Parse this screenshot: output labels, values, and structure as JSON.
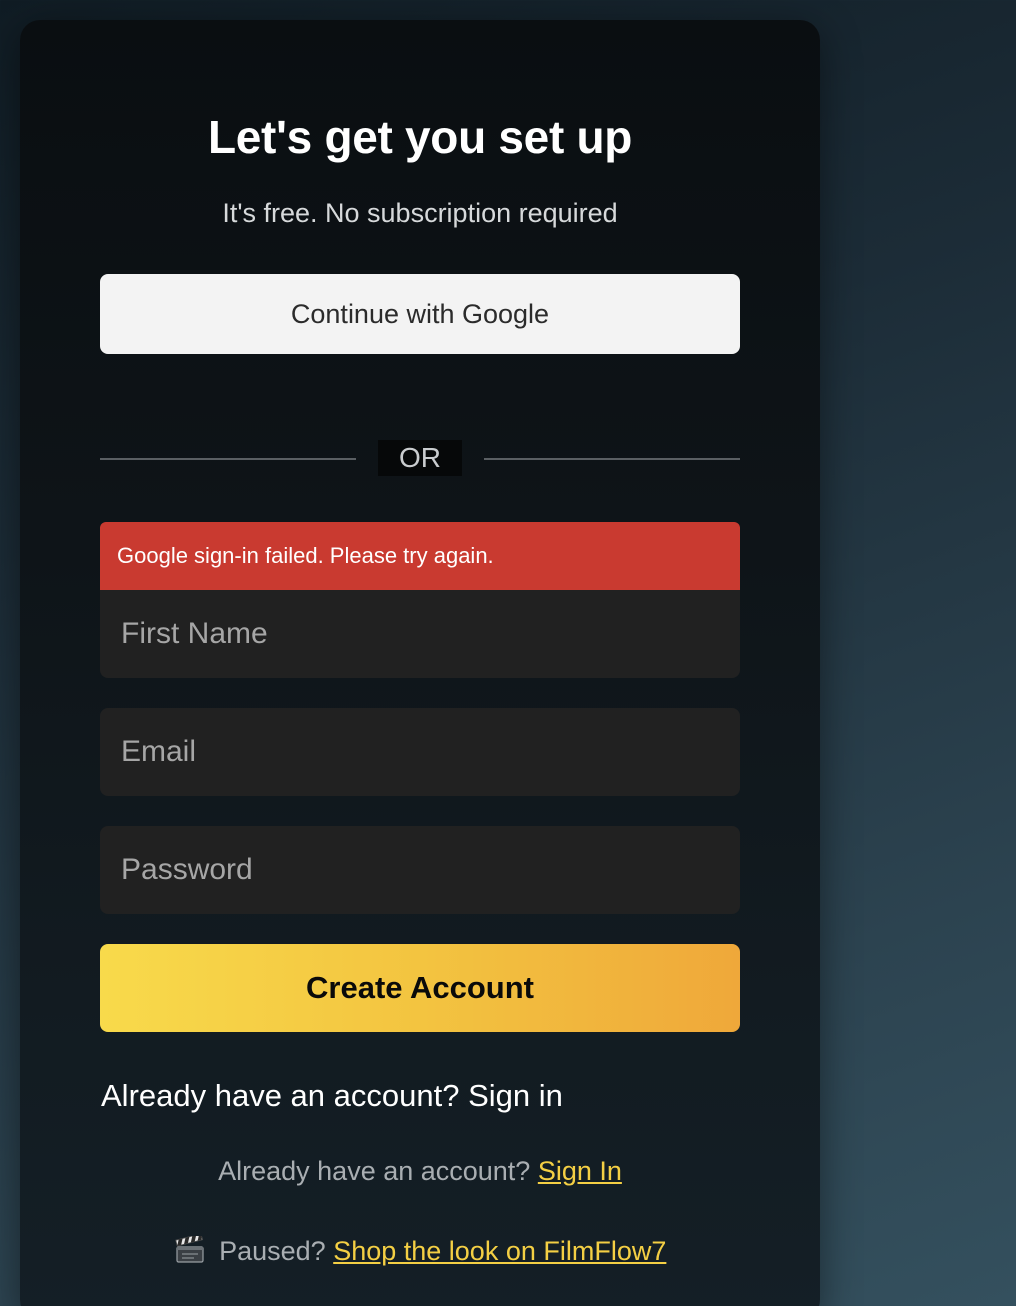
{
  "header": {
    "title": "Let's get you set up",
    "subtitle": "It's free. No subscription required"
  },
  "google_button": {
    "label": "Continue with Google"
  },
  "divider": {
    "label": "OR"
  },
  "error": {
    "message": "Google sign-in failed. Please try again."
  },
  "form": {
    "first_name": {
      "placeholder": "First Name",
      "value": ""
    },
    "email": {
      "placeholder": "Email",
      "value": ""
    },
    "password": {
      "placeholder": "Password",
      "value": ""
    },
    "submit_label": "Create Account"
  },
  "signin_prompt": {
    "text": "Already have an account? Sign in"
  },
  "footer": {
    "signin_text": "Already have an account? ",
    "signin_link": "Sign In",
    "shop_icon": "clapperboard-icon",
    "shop_text": " Paused? ",
    "shop_link": "Shop the look on FilmFlow7"
  },
  "colors": {
    "accent": "#f4cf44",
    "error": "#c93a30",
    "button_gradient_start": "#f8da4b",
    "button_gradient_end": "#efa83a",
    "card_background": "#0e1418"
  }
}
